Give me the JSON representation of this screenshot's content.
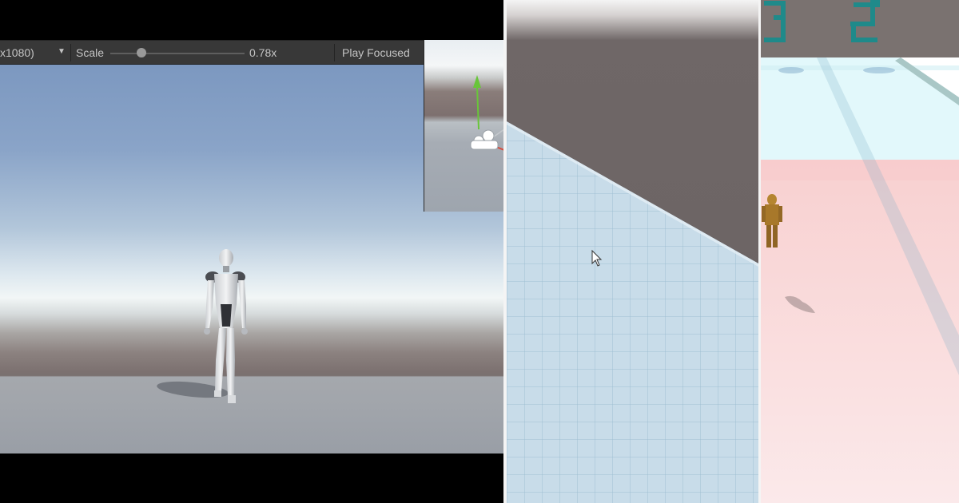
{
  "game_view": {
    "toolbar": {
      "resolution_label": "x1080)",
      "resolution_icon": "chevron-down-icon",
      "scale_label": "Scale",
      "scale_value": "0.78x",
      "scale_level": 0.78,
      "play_mode_label": "Play Focused"
    }
  },
  "scene_inset": {
    "gizmo_icon": "move-gizmo-icon",
    "camera_icon": "camera-icon"
  },
  "grid_view": {
    "cursor_icon": "mouse-cursor-icon"
  },
  "colors": {
    "toolbar_bg": "#383838",
    "toolbar_text": "#c4c4c4",
    "gizmo_green": "#69c53a",
    "grid_floor": "#c8dce9",
    "wall": "#6d6565",
    "zone_red": "#f7d6d6",
    "zone_cyan": "#e2f8fb",
    "teal_structure": "#1f8a8a",
    "character_gold": "#a8782a"
  }
}
